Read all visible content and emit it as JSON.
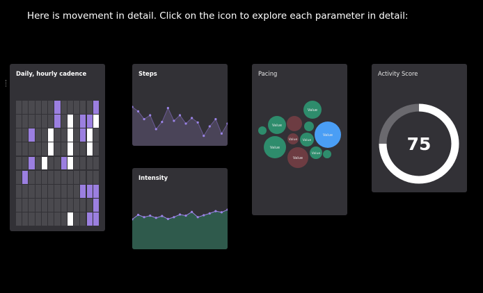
{
  "intro_text": "Here is movement in detail. Click on the icon to explore each parameter in detail:",
  "colors": {
    "background": "#000000",
    "card": "#323136",
    "heat_empty": "#4a494e",
    "heat_purple": "#9b7fe0",
    "heat_white": "#ffffff",
    "steps_fill": "#4a4458",
    "steps_line": "#6b5a96",
    "intensity_fill": "#2f5a4c",
    "accent_point": "#9b84e8",
    "bubble_green": "#2e8c6c",
    "bubble_maroon": "#6d3c42",
    "bubble_blue": "#4a9ef5",
    "ring_active": "#ffffff",
    "ring_track": "#6a696e"
  },
  "cadence": {
    "title": "Daily, hourly cadence",
    "grid": [
      [
        0,
        0,
        0,
        0,
        0,
        0,
        1,
        0,
        0,
        0,
        0,
        0,
        1
      ],
      [
        0,
        0,
        0,
        0,
        0,
        0,
        1,
        0,
        2,
        0,
        1,
        1,
        2
      ],
      [
        0,
        0,
        1,
        0,
        0,
        2,
        0,
        0,
        2,
        0,
        1,
        2,
        0
      ],
      [
        0,
        0,
        0,
        0,
        0,
        2,
        0,
        0,
        2,
        0,
        0,
        2,
        0
      ],
      [
        0,
        0,
        1,
        0,
        2,
        0,
        0,
        1,
        2,
        0,
        0,
        0,
        0
      ],
      [
        0,
        1,
        0,
        0,
        0,
        0,
        0,
        0,
        0,
        0,
        0,
        0,
        0
      ],
      [
        0,
        0,
        0,
        0,
        0,
        0,
        0,
        0,
        0,
        0,
        1,
        1,
        1
      ],
      [
        0,
        0,
        0,
        0,
        0,
        0,
        0,
        0,
        0,
        0,
        0,
        0,
        1
      ],
      [
        0,
        0,
        0,
        0,
        0,
        0,
        0,
        0,
        2,
        0,
        0,
        1,
        1
      ]
    ]
  },
  "steps": {
    "title": "Steps",
    "values": [
      60,
      52,
      38,
      45,
      20,
      33,
      58,
      35,
      45,
      30,
      40,
      32,
      8,
      25,
      38,
      12,
      30
    ]
  },
  "intensity": {
    "title": "Intensity",
    "values": [
      30,
      42,
      36,
      40,
      34,
      39,
      31,
      36,
      43,
      40,
      50,
      36,
      41,
      46,
      52,
      49,
      56
    ]
  },
  "pacing": {
    "title": "Pacing",
    "bubbles": [
      {
        "label": "Value",
        "color": "green",
        "r": 13
      },
      {
        "label": "Value",
        "color": "green",
        "r": 13
      },
      {
        "label": "",
        "color": "maroon",
        "r": 11
      },
      {
        "label": "",
        "color": "green",
        "r": 7
      },
      {
        "label": "",
        "color": "green",
        "r": 6
      },
      {
        "label": "Value",
        "color": "blue",
        "r": 19
      },
      {
        "label": "Value",
        "color": "green",
        "r": 16
      },
      {
        "label": "Value",
        "color": "maroon",
        "r": 8
      },
      {
        "label": "Value",
        "color": "green",
        "r": 10
      },
      {
        "label": "Value",
        "color": "maroon",
        "r": 15
      },
      {
        "label": "Value",
        "color": "green",
        "r": 9
      },
      {
        "label": "",
        "color": "green",
        "r": 6
      }
    ]
  },
  "score": {
    "title": "Activity Score",
    "value": 75,
    "max": 100
  }
}
